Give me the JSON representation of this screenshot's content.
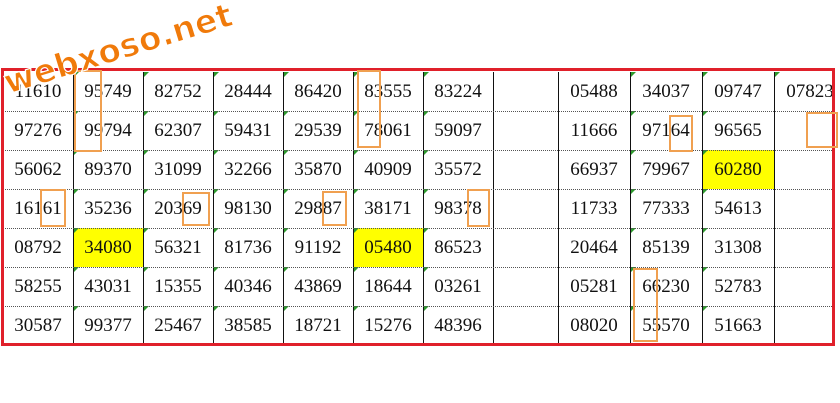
{
  "watermark": {
    "text": "webxoso.net",
    "color": "#f07a0a"
  },
  "colors": {
    "frame": "#e0202a",
    "highlight": "#ffff00",
    "marker_box": "#f0a050",
    "cell_marker": "#2e9b2e"
  },
  "left_table": [
    [
      "11610",
      "95749",
      "82752",
      "28444",
      "86420",
      "83555",
      "83224"
    ],
    [
      "97276",
      "99794",
      "62307",
      "59431",
      "29539",
      "78061",
      "59097"
    ],
    [
      "56062",
      "89370",
      "31099",
      "32266",
      "35870",
      "40909",
      "35572"
    ],
    [
      "16161",
      "35236",
      "20369",
      "98130",
      "29887",
      "38171",
      "98378"
    ],
    [
      "08792",
      "34080",
      "56321",
      "81736",
      "91192",
      "05480",
      "86523"
    ],
    [
      "58255",
      "43031",
      "15355",
      "40346",
      "43869",
      "18644",
      "03261"
    ],
    [
      "30587",
      "99377",
      "25467",
      "38585",
      "18721",
      "15276",
      "48396"
    ]
  ],
  "right_table": [
    [
      "05488",
      "34037",
      "09747",
      "07823"
    ],
    [
      "11666",
      "97164",
      "96565",
      ""
    ],
    [
      "66937",
      "79967",
      "60280",
      ""
    ],
    [
      "11733",
      "77333",
      "54613",
      ""
    ],
    [
      "20464",
      "85139",
      "31308",
      ""
    ],
    [
      "05281",
      "66230",
      "52783",
      ""
    ],
    [
      "08020",
      "55570",
      "51663",
      ""
    ]
  ]
}
